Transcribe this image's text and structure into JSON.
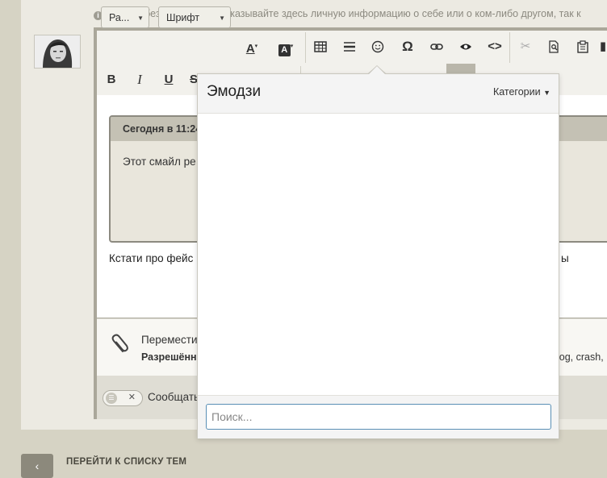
{
  "notice": {
    "text": "В целях безопасности не указывайте здесь личную информацию о себе или о ком-либо другом, так к"
  },
  "toolbar": {
    "paragraph_dropdown": "Ра...",
    "font_dropdown": "Шрифт",
    "bold": "B",
    "italic": "I",
    "underline": "U",
    "strike": "S"
  },
  "quote": {
    "header": "Сегодня в 11:24",
    "body": "Этот смайл ре"
  },
  "editor": {
    "text_left": "Кстати про фейс",
    "text_right": "ы"
  },
  "attach": {
    "label": "Переместит",
    "allowed": "Разрешённ",
    "extensions": "log, crash,"
  },
  "footer": {
    "label": "Сообщать"
  },
  "emoji_popup": {
    "title": "Эмодзи",
    "categories": "Категории",
    "search_placeholder": "Поиск..."
  },
  "nav": {
    "label": "ПЕРЕЙТИ К СПИСКУ ТЕМ"
  },
  "colors": {
    "page_bg": "#d6d3c4",
    "quote_border": "#8c8a80",
    "search_border": "#5a8fb5"
  }
}
